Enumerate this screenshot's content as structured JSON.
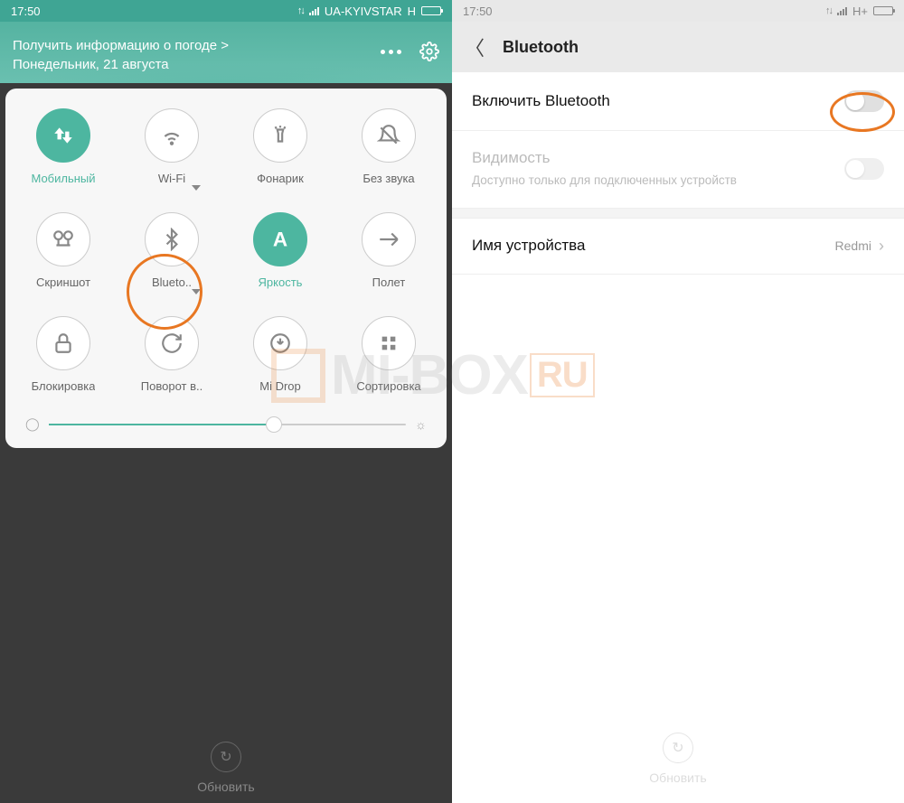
{
  "left": {
    "status": {
      "time": "17:50",
      "carrier": "UA-KYIVSTAR",
      "network": "H"
    },
    "weather_line": "Получить информацию о погоде >",
    "date_line": "Понедельник, 21 августа",
    "tiles": [
      {
        "label": "Мобильный",
        "icon": "data",
        "active": true
      },
      {
        "label": "Wi-Fi",
        "icon": "wifi",
        "active": false,
        "tri": true
      },
      {
        "label": "Фонарик",
        "icon": "flashlight",
        "active": false
      },
      {
        "label": "Без звука",
        "icon": "mute",
        "active": false
      },
      {
        "label": "Скриншот",
        "icon": "screenshot",
        "active": false
      },
      {
        "label": "Blueto..",
        "icon": "bluetooth",
        "active": false,
        "tri": true,
        "highlight": true
      },
      {
        "label": "Яркость",
        "icon": "brightness-a",
        "active": true
      },
      {
        "label": "Полет",
        "icon": "airplane",
        "active": false
      },
      {
        "label": "Блокировка",
        "icon": "lock",
        "active": false
      },
      {
        "label": "Поворот в..",
        "icon": "rotate",
        "active": false
      },
      {
        "label": "Mi Drop",
        "icon": "midrop",
        "active": false
      },
      {
        "label": "Сортировка",
        "icon": "grid",
        "active": false
      }
    ],
    "refresh": "Обновить"
  },
  "right": {
    "status": {
      "time": "17:50",
      "network": "H+"
    },
    "title": "Bluetooth",
    "rows": {
      "enable": {
        "label": "Включить Bluetooth"
      },
      "visibility": {
        "label": "Видимость",
        "desc": "Доступно только для подключенных устройств"
      },
      "device_name": {
        "label": "Имя устройства",
        "value": "Redmi"
      }
    },
    "refresh": "Обновить"
  },
  "watermark_main": "MI-BOX",
  "watermark_suffix": "RU"
}
